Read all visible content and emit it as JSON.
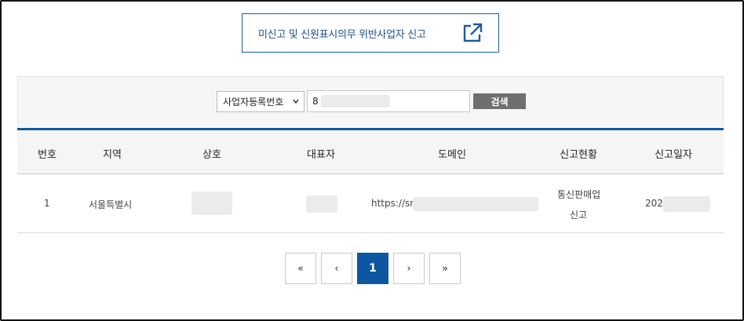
{
  "report_button": {
    "label": "미신고 및 신원표시의무 위반사업자 신고",
    "icon": "external-link-icon"
  },
  "search": {
    "select_value": "사업자등록번호",
    "input_value": "8",
    "button_label": "검색"
  },
  "table": {
    "headers": [
      "번호",
      "지역",
      "상호",
      "대표자",
      "도메인",
      "신고현황",
      "신고일자"
    ],
    "row": {
      "no": "1",
      "region": "서울특별시",
      "domain": "https://sr",
      "status_line1": "통신판매업",
      "status_line2": "신고",
      "date": "202"
    }
  },
  "pagination": {
    "first": "«",
    "prev": "‹",
    "current": "1",
    "next": "›",
    "last": "»"
  },
  "colors": {
    "primary": "#0d57a2",
    "button_gray": "#6f6f6f"
  }
}
